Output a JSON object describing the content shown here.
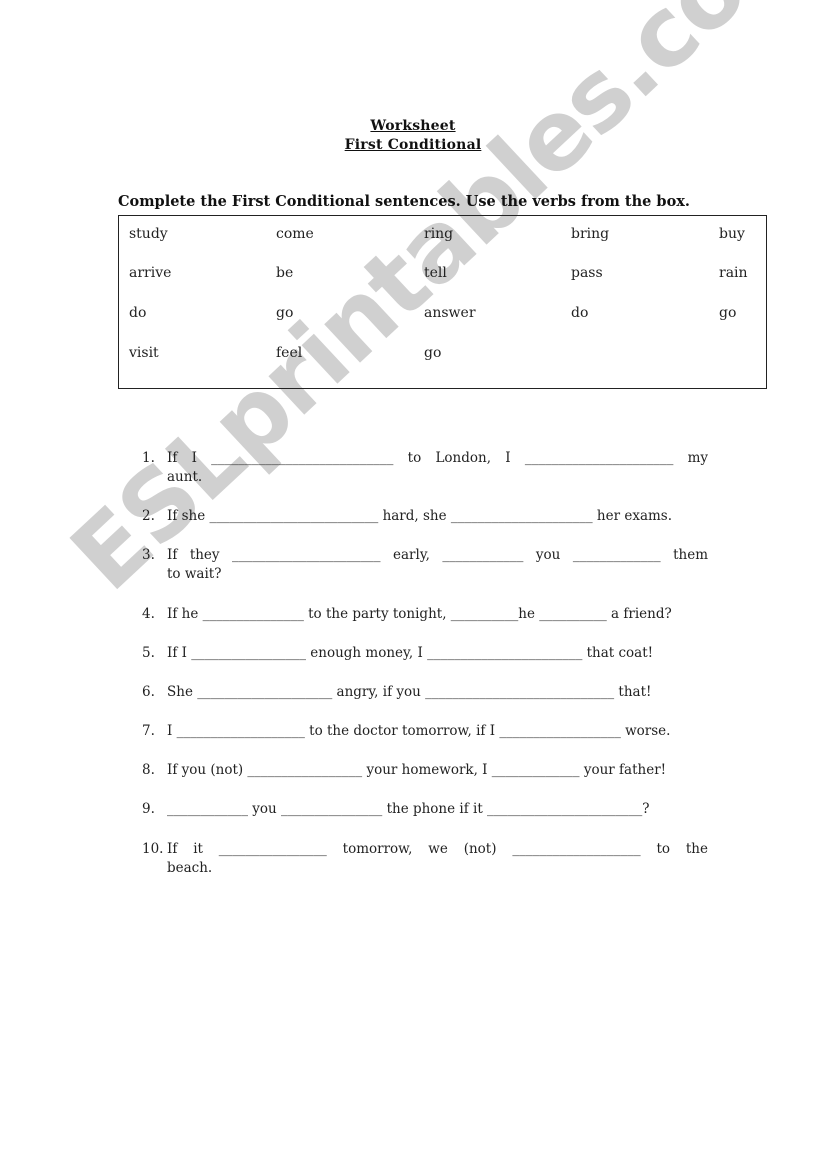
{
  "header": {
    "title": "Worksheet",
    "subtitle": "First Conditional"
  },
  "instructions": "Complete the First Conditional sentences. Use the verbs from the box.",
  "verb_box": {
    "rows": [
      [
        "study",
        "come",
        "ring",
        "bring",
        "buy"
      ],
      [
        "arrive",
        "be",
        "tell",
        "pass",
        "rain"
      ],
      [
        "do",
        "go",
        "answer",
        "do",
        "go"
      ],
      [
        "visit",
        "feel",
        "go",
        "",
        ""
      ]
    ]
  },
  "exercises": [
    {
      "number": "1.",
      "line1": "If  I  ___________________________  to  London,  I  ______________________  my",
      "line2": "aunt."
    },
    {
      "number": "2.",
      "line1": "If she _________________________ hard, she _____________________ her exams.",
      "line2": ""
    },
    {
      "number": "3.",
      "line1": "If they ______________________ early, ____________ you _____________ them",
      "line2": "to wait?"
    },
    {
      "number": "4.",
      "line1": "If he _______________ to the party tonight, __________he __________ a friend?",
      "line2": ""
    },
    {
      "number": "5.",
      "line1": "If I _________________ enough money, I _______________________ that coat!",
      "line2": ""
    },
    {
      "number": "6.",
      "line1": "She ____________________ angry, if you ____________________________ that!",
      "line2": ""
    },
    {
      "number": "7.",
      "line1": "I ___________________ to the doctor tomorrow, if I __________________ worse.",
      "line2": ""
    },
    {
      "number": "8.",
      "line1": "If you (not) _________________ your homework, I _____________ your father!",
      "line2": ""
    },
    {
      "number": "9.",
      "line1": "____________ you _______________ the phone if it _______________________?",
      "line2": ""
    },
    {
      "number": "10.",
      "line1": "If  it  ________________  tomorrow,  we  (not)  ___________________  to  the",
      "line2": "beach."
    }
  ],
  "watermark": "ESLprintables.com"
}
